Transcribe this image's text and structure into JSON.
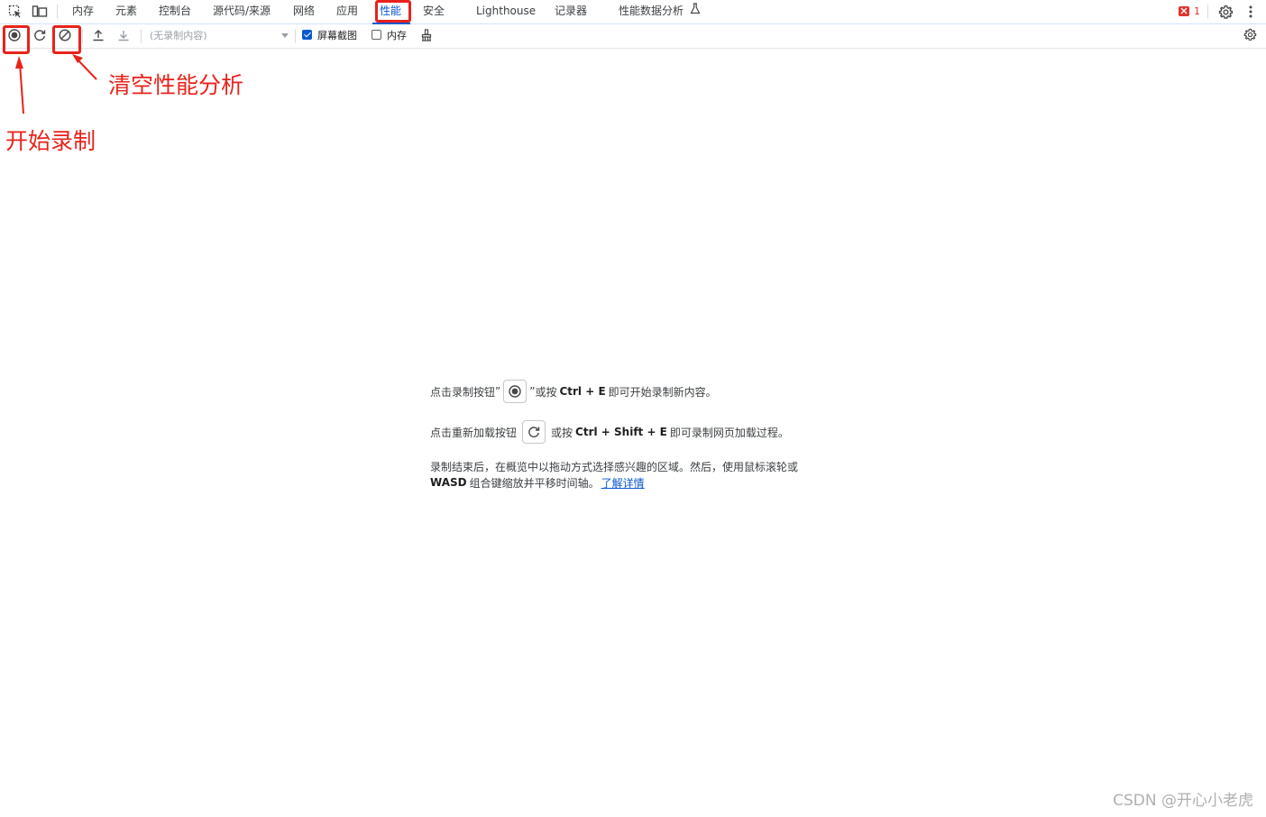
{
  "tabs": [
    {
      "label": "内存"
    },
    {
      "label": "元素"
    },
    {
      "label": "控制台"
    },
    {
      "label": "源代码/来源"
    },
    {
      "label": "网络"
    },
    {
      "label": "应用"
    },
    {
      "label": "性能",
      "active": true
    },
    {
      "label": "安全"
    },
    {
      "label": "Lighthouse"
    },
    {
      "label": "记录器"
    },
    {
      "label": "性能数据分析"
    }
  ],
  "issues_count": "1",
  "toolbar": {
    "select_placeholder": "(无录制内容)",
    "screenshot_label": "屏幕截图",
    "screenshot_checked": true,
    "memory_label": "内存",
    "memory_checked": false
  },
  "annotations": {
    "clear_label": "清空性能分析",
    "record_label": "开始录制"
  },
  "instructions": {
    "line1_a": "点击录制按钮",
    "line1_quote_open": "”",
    "line1_quote_close": "”",
    "line1_b": "或按",
    "line1_key": "Ctrl + E",
    "line1_c": "即可开始录制新内容。",
    "line2_a": "点击重新加载按钮",
    "line2_b": "或按",
    "line2_key": "Ctrl + Shift + E",
    "line2_c": "即可录制网页加载过程。",
    "line3": "录制结束后，在概览中以拖动方式选择感兴趣的区域。然后，使用鼠标滚轮或",
    "line4_key": "WASD",
    "line4": "组合键缩放并平移时间轴。",
    "learn_more": "了解详情"
  },
  "watermark": "CSDN @开心小老虎",
  "colors": {
    "accent": "#0b57d0",
    "annotation": "#e8231b"
  }
}
